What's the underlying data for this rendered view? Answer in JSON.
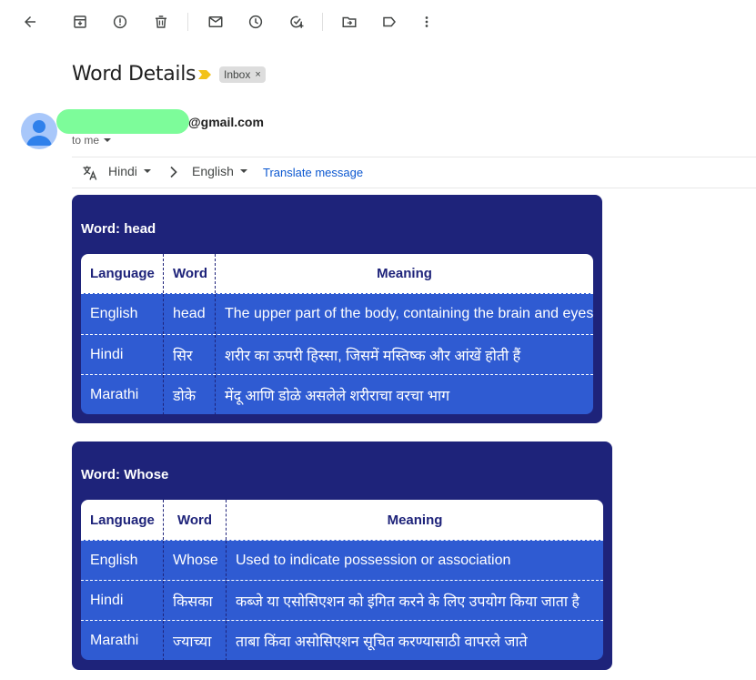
{
  "toolbar": {
    "icons": [
      "back-arrow-icon",
      "archive-icon",
      "report-spam-icon",
      "delete-icon",
      "mark-unread-icon",
      "snooze-icon",
      "add-to-tasks-icon",
      "move-to-icon",
      "label-icon",
      "more-icon"
    ]
  },
  "email": {
    "subject": "Word Details",
    "label": "Inbox",
    "sender_domain": "@gmail.com",
    "to": "to me"
  },
  "translate": {
    "from": "Hindi",
    "to": "English",
    "action": "Translate message"
  },
  "cards": [
    {
      "title": "Word: head",
      "headers": [
        "Language",
        "Word",
        "Meaning"
      ],
      "rows": [
        [
          "English",
          "head",
          "The upper part of the body, containing the brain and eyes"
        ],
        [
          "Hindi",
          "सिर",
          "शरीर का ऊपरी हिस्सा, जिसमें मस्तिष्क और आंखें होती हैं"
        ],
        [
          "Marathi",
          "डोके",
          "मेंदू आणि डोळे असलेले शरीराचा वरचा भाग"
        ]
      ]
    },
    {
      "title": "Word: Whose",
      "headers": [
        "Language",
        "Word",
        "Meaning"
      ],
      "rows": [
        [
          "English",
          "Whose",
          "Used to indicate possession or association"
        ],
        [
          "Hindi",
          "किसका",
          "कब्जे या एसोसिएशन को इंगित करने के लिए उपयोग किया जाता है"
        ],
        [
          "Marathi",
          "ज्याच्या",
          "ताबा किंवा असोसिएशन सूचित करण्यासाठी वापरले जाते"
        ]
      ]
    }
  ]
}
